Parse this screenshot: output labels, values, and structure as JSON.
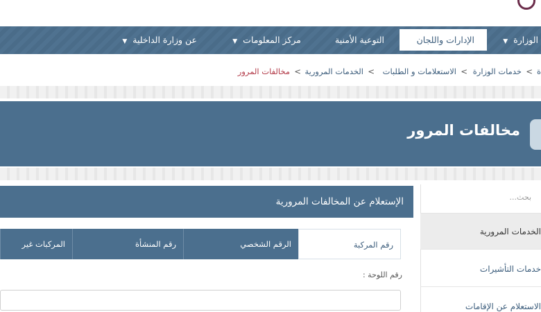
{
  "nav": {
    "items": [
      {
        "label": "الوزارة",
        "dropdown": true
      },
      {
        "label": "الإدارات واللجان",
        "active": true
      },
      {
        "label": "التوعية الأمنية"
      },
      {
        "label": "مركز المعلومات",
        "dropdown": true
      },
      {
        "label": "عن وزارة الداخلية",
        "dropdown": true
      }
    ]
  },
  "breadcrumb": {
    "items": [
      "ة",
      "خدمات الوزارة",
      "الاستعلامات و الطلبات",
      "الخدمات المرورية",
      "مخالفات المرور"
    ],
    "separator": ">"
  },
  "banner": {
    "title": "مخالفات المرور"
  },
  "sidebar": {
    "search_placeholder": "بحث...",
    "items": [
      "الخدمات المرورية",
      "خدمات التأشيرات",
      "الاستعلام عن الإقامات"
    ]
  },
  "main": {
    "title": "الإستعلام عن المخالفات المرورية",
    "tabs": [
      "رقم المركبة",
      "الرقم الشخصي",
      "رقم المنشأة",
      "المركبات غير القطرية"
    ],
    "plate_label": "رقم اللوحة :",
    "plate_value": ""
  },
  "colors": {
    "primary": "#4b6f8e",
    "breadcrumb_current": "#b23a48",
    "link": "#3c5d7c"
  }
}
